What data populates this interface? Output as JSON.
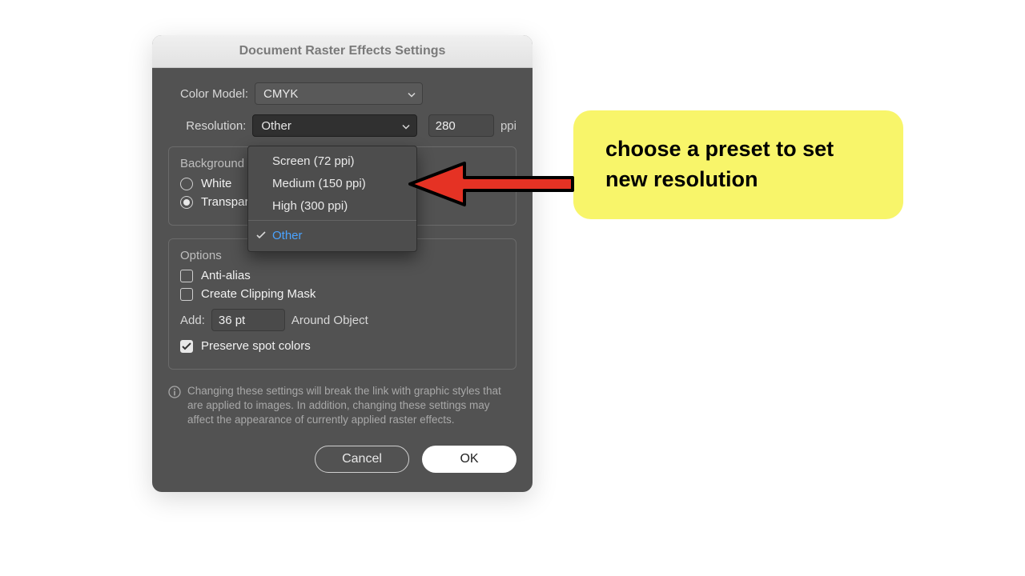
{
  "dialog": {
    "title": "Document Raster Effects Settings",
    "color_model": {
      "label": "Color Model:",
      "value": "CMYK"
    },
    "resolution": {
      "label": "Resolution:",
      "value": "Other",
      "custom_value": "280",
      "unit": "ppi",
      "options": [
        "Screen (72 ppi)",
        "Medium (150 ppi)",
        "High (300 ppi)",
        "Other"
      ],
      "selected_index": 3
    },
    "background": {
      "title": "Background",
      "options": {
        "white": "White",
        "transparent": "Transparent"
      },
      "selected": "transparent"
    },
    "options": {
      "title": "Options",
      "anti_alias": {
        "label": "Anti-alias",
        "checked": false
      },
      "clipping_mask": {
        "label": "Create Clipping Mask",
        "checked": false
      },
      "add": {
        "label_pre": "Add:",
        "value": "36 pt",
        "label_post": "Around Object"
      },
      "preserve_spot": {
        "label": "Preserve spot colors",
        "checked": true
      }
    },
    "info": "Changing these settings will break the link with graphic styles that are applied to images. In addition, changing these settings may affect the appearance of currently applied raster effects.",
    "buttons": {
      "cancel": "Cancel",
      "ok": "OK"
    }
  },
  "callout": "choose a preset to set new resolution"
}
